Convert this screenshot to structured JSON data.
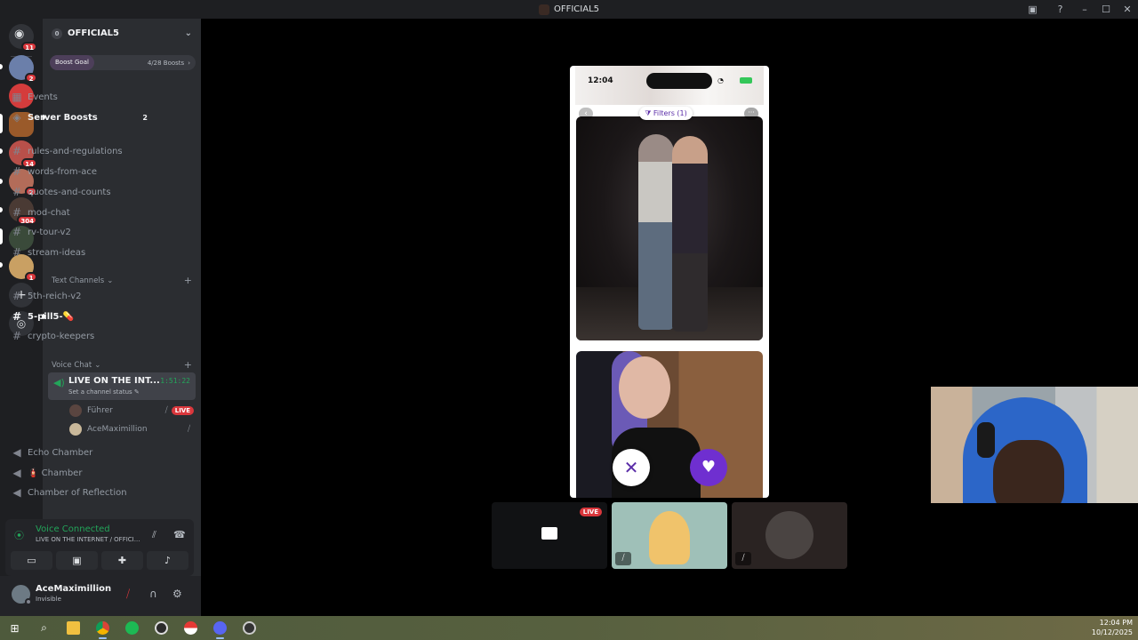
{
  "window": {
    "title": "OFFICIAL5"
  },
  "rail": {
    "home_badge": "11",
    "servers": [
      {
        "badge": "2",
        "color": "#6b7faa"
      },
      {
        "badge": "",
        "color": "#d43c3c"
      },
      {
        "badge": "",
        "color": "#9a5a2a"
      },
      {
        "badge": "14",
        "color": "#b8504a"
      },
      {
        "badge": "2",
        "color": "#b36c59"
      },
      {
        "badge": "304",
        "color": "#4a3a34"
      },
      {
        "badge": "",
        "color": "#3a4a3a"
      },
      {
        "badge": "1",
        "color": "#c9a063"
      }
    ]
  },
  "sidebar": {
    "server_name": "OFFICIAL5",
    "boost_goal": {
      "label": "Boost Goal",
      "count": "4/28 Boosts"
    },
    "top_items": [
      {
        "label": "Events",
        "count": ""
      },
      {
        "label": "Server Boosts",
        "count": "2"
      }
    ],
    "channels": [
      "rules-and-regulations",
      "words-from-ace",
      "quotes-and-counts",
      "mod-chat",
      "rv-tour-v2",
      "stream-ideas"
    ],
    "text_category": "Text Channels",
    "text_channels": [
      "5th-reich-v2",
      "5-pill5-💊",
      "crypto-keepers"
    ],
    "voice_category": "Voice Chat",
    "active_voice": {
      "name": "LIVE ON THE INT...",
      "status": "Set a channel status",
      "timer": "1:51:22"
    },
    "voice_users": [
      {
        "name": "Führer",
        "live": "LIVE"
      },
      {
        "name": "AceMaximillion",
        "live": ""
      }
    ],
    "voice_channels": [
      "Echo Chamber",
      "🧯 Chamber",
      "Chamber of Reflection"
    ]
  },
  "voice_panel": {
    "title": "Voice Connected",
    "subtitle": "LIVE ON THE INTERNET / OFFICI..."
  },
  "user": {
    "name": "AceMaximillion",
    "status": "Invisible"
  },
  "stream": {
    "phone_time": "12:04",
    "filters_label": "Filters (1)"
  },
  "tiles": {
    "live_label": "LIVE"
  },
  "taskbar": {
    "time": "12:04 PM",
    "date": "10/12/2025"
  }
}
